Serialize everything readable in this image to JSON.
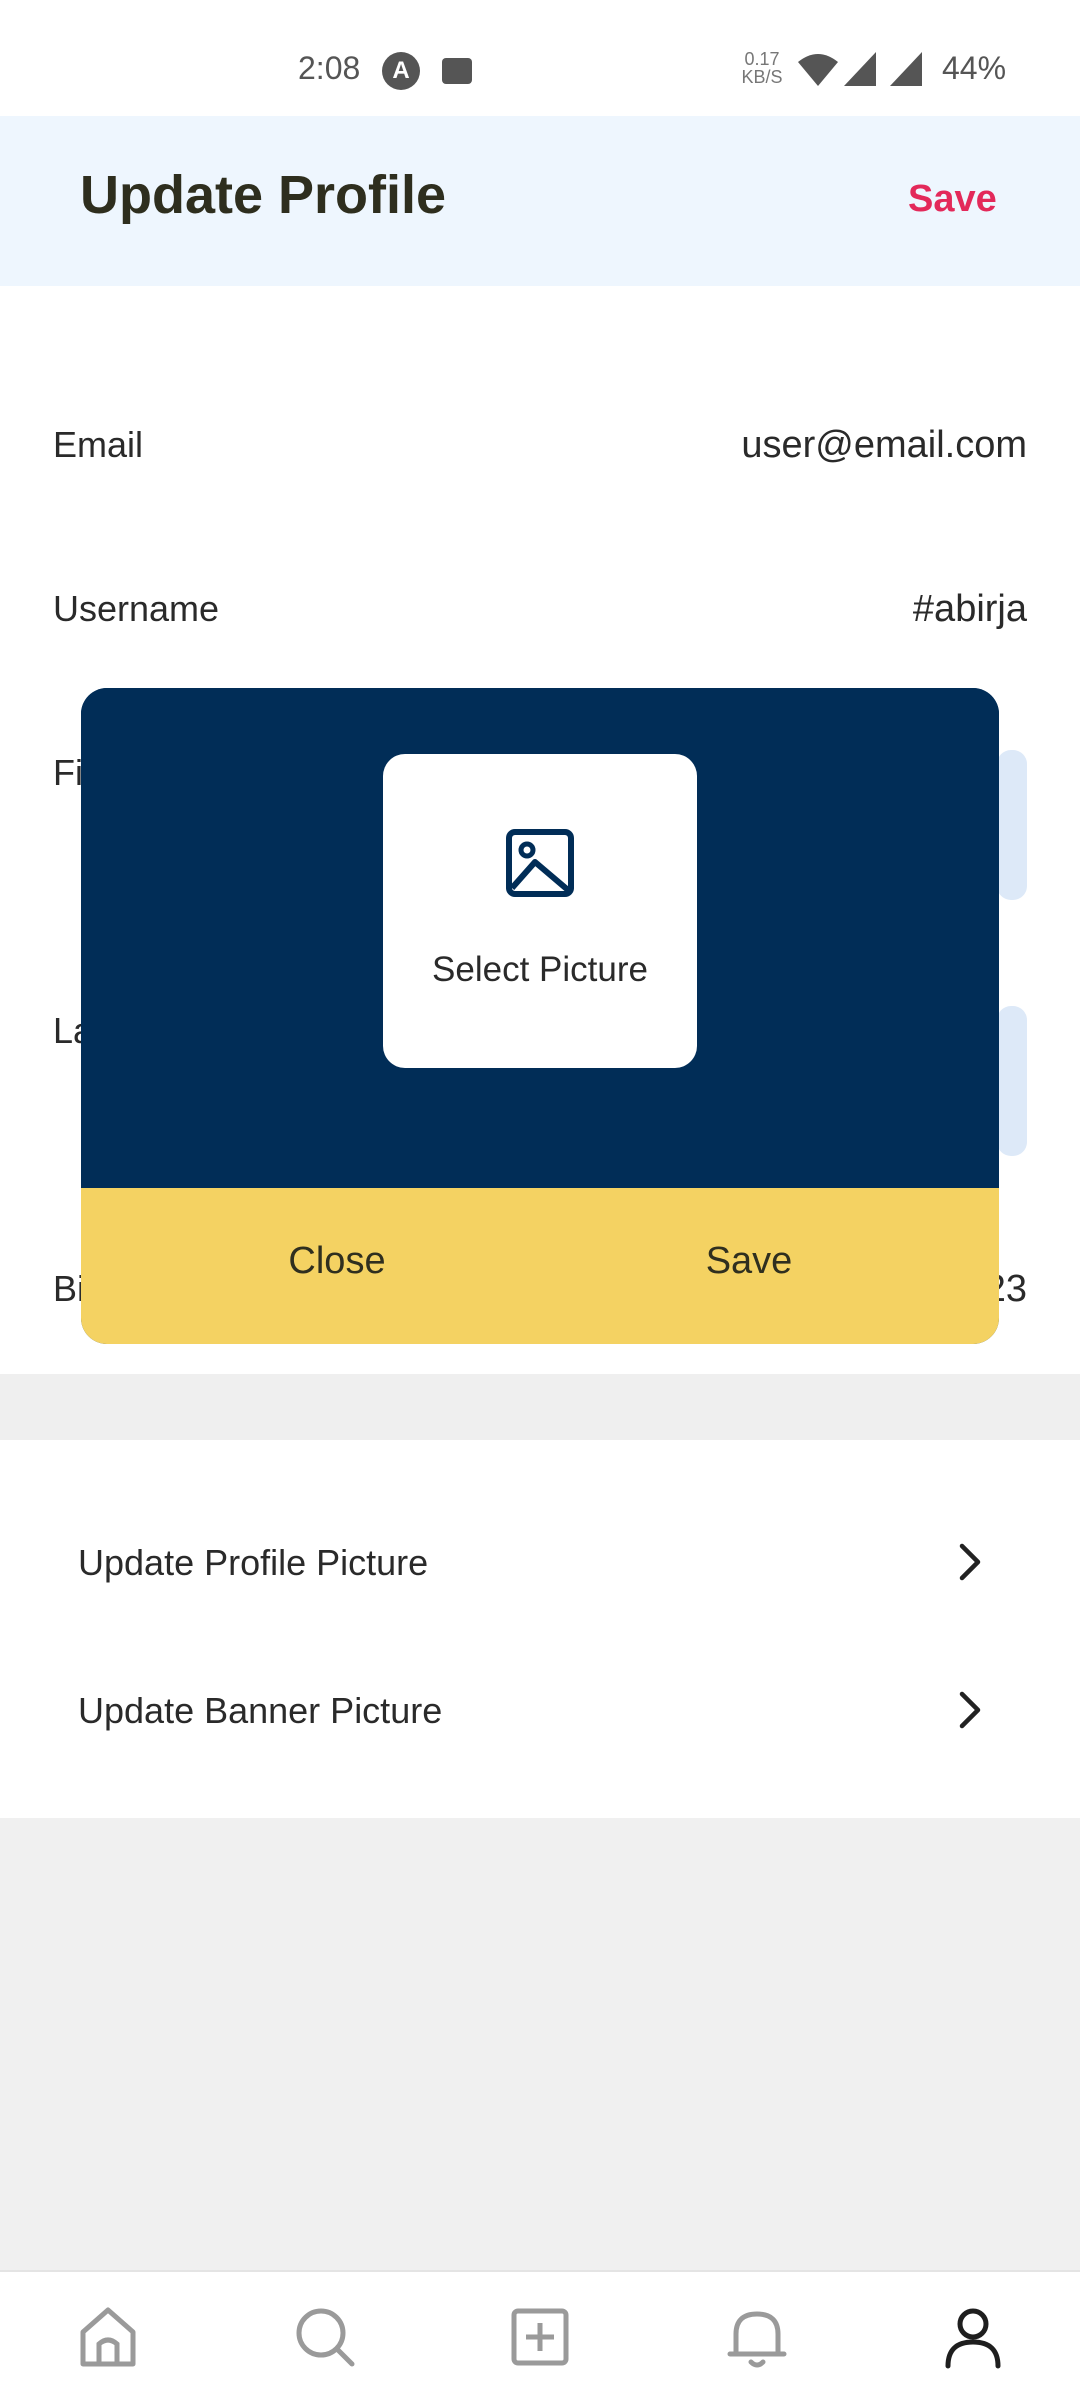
{
  "status_bar": {
    "time": "2:08",
    "notification_icons": [
      "a-icon",
      "image-icon"
    ],
    "net_speed_value": "0.17",
    "net_speed_unit": "KB/S",
    "battery": "44%"
  },
  "header": {
    "title": "Update Profile",
    "save_label": "Save",
    "accent_color": "#e3295a",
    "background_color": "#eef6fe"
  },
  "form": {
    "email": {
      "label": "Email",
      "value": "user@email.com"
    },
    "username": {
      "label": "Username",
      "value": "#abirja"
    },
    "first_name": {
      "label_visible": "Fi"
    },
    "last_name": {
      "label_visible": "La"
    },
    "birthday": {
      "label_visible": "Bi",
      "value_visible": "23"
    }
  },
  "links": [
    {
      "label": "Update Profile Picture"
    },
    {
      "label": "Update Banner Picture"
    }
  ],
  "modal": {
    "select_picture_label": "Select Picture",
    "close_label": "Close",
    "save_label": "Save",
    "colors": {
      "panel": "#012d57",
      "actions": "#f4d262"
    }
  },
  "bottom_nav": {
    "items": [
      "home-icon",
      "search-icon",
      "add-icon",
      "bell-icon",
      "profile-icon"
    ],
    "active": "profile-icon"
  }
}
